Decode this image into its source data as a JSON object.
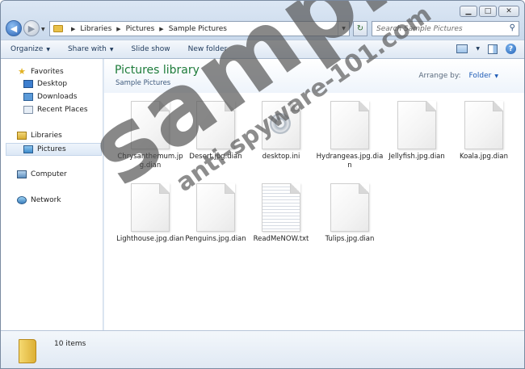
{
  "address": {
    "crumbs": [
      "Libraries",
      "Pictures",
      "Sample Pictures"
    ]
  },
  "search": {
    "placeholder": "Search Sample Pictures"
  },
  "toolbar": {
    "organize": "Organize",
    "share_with": "Share with",
    "slide_show": "Slide show",
    "new_folder": "New folder"
  },
  "nav": {
    "favorites": "Favorites",
    "desktop": "Desktop",
    "downloads": "Downloads",
    "recent_places": "Recent Places",
    "libraries": "Libraries",
    "pictures": "Pictures",
    "computer": "Computer",
    "network": "Network"
  },
  "library": {
    "title": "Pictures library",
    "subtitle": "Sample Pictures",
    "arrange_label": "Arrange by:",
    "arrange_value": "Folder"
  },
  "files": [
    {
      "name": "Chrysanthemum.jpg.dian",
      "kind": "blank"
    },
    {
      "name": "Desert.jpg.dian",
      "kind": "blank"
    },
    {
      "name": "desktop.ini",
      "kind": "ini"
    },
    {
      "name": "Hydrangeas.jpg.dian",
      "kind": "blank"
    },
    {
      "name": "Jellyfish.jpg.dian",
      "kind": "blank"
    },
    {
      "name": "Koala.jpg.dian",
      "kind": "blank"
    },
    {
      "name": "Lighthouse.jpg.dian",
      "kind": "blank"
    },
    {
      "name": "Penguins.jpg.dian",
      "kind": "blank"
    },
    {
      "name": "ReadMeNOW.txt",
      "kind": "txt"
    },
    {
      "name": "Tulips.jpg.dian",
      "kind": "blank"
    }
  ],
  "details": {
    "item_count": "10 items"
  },
  "watermark": {
    "big": "sample",
    "small": "anti-spyware-101.com"
  }
}
